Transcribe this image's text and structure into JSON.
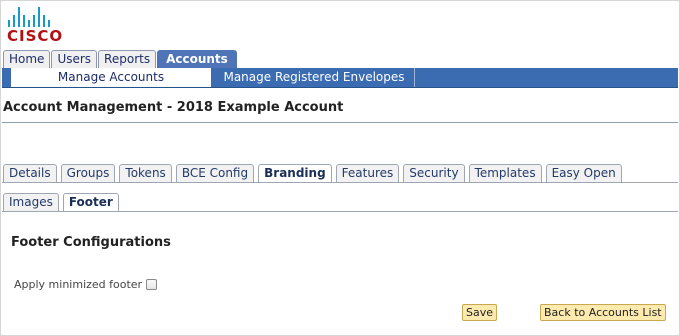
{
  "brand": {
    "logo_text": "CISCO",
    "bar_color": "#159bc6",
    "text_color": "#b31111"
  },
  "top_tabs": [
    {
      "label": "Home"
    },
    {
      "label": "Users"
    },
    {
      "label": "Reports"
    },
    {
      "label": "Accounts",
      "active": true
    }
  ],
  "sub_nav": {
    "active_label": "Manage Accounts",
    "other_label": "Manage Registered Envelopes"
  },
  "page_title": "Account Management - 2018 Example Account",
  "settings_tabs": [
    {
      "label": "Details"
    },
    {
      "label": "Groups"
    },
    {
      "label": "Tokens"
    },
    {
      "label": "BCE Config"
    },
    {
      "label": "Branding",
      "active": true
    },
    {
      "label": "Features"
    },
    {
      "label": "Security"
    },
    {
      "label": "Templates"
    },
    {
      "label": "Easy Open"
    }
  ],
  "branding_tabs": [
    {
      "label": "Images"
    },
    {
      "label": "Footer",
      "active": true
    }
  ],
  "footer_config": {
    "heading": "Footer Configurations",
    "apply_minimized_label": "Apply minimized footer",
    "apply_minimized_checked": false
  },
  "actions": {
    "save_label": "Save",
    "back_label": "Back to Accounts List"
  },
  "colors": {
    "nav_blue": "#3b6bb1",
    "active_tab": "#4f74b8",
    "button_fill": "#fdeaae"
  }
}
